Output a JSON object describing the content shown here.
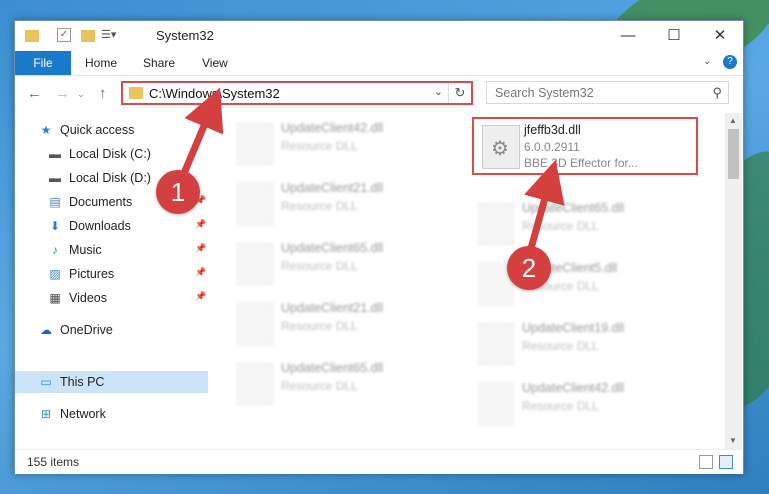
{
  "window": {
    "title": "System32",
    "controls": {
      "minimize": "—",
      "maximize": "☐",
      "close": "✕"
    }
  },
  "ribbon": {
    "tabs": [
      "File",
      "Home",
      "Share",
      "View"
    ],
    "help_icon": "?"
  },
  "address": {
    "path": "C:\\Windows\\System32",
    "search_placeholder": "Search System32"
  },
  "sidebar": {
    "items": [
      {
        "label": "Quick access",
        "icon": "star-icon",
        "pinned": false
      },
      {
        "label": "Local Disk (C:)",
        "icon": "drive-icon",
        "pinned": false
      },
      {
        "label": "Local Disk (D:)",
        "icon": "drive-icon",
        "pinned": false
      },
      {
        "label": "Documents",
        "icon": "document-icon",
        "pinned": true
      },
      {
        "label": "Downloads",
        "icon": "download-icon",
        "pinned": true
      },
      {
        "label": "Music",
        "icon": "music-icon",
        "pinned": true
      },
      {
        "label": "Pictures",
        "icon": "picture-icon",
        "pinned": true
      },
      {
        "label": "Videos",
        "icon": "video-icon",
        "pinned": true
      },
      {
        "label": "OneDrive",
        "icon": "cloud-icon",
        "pinned": false
      },
      {
        "label": "This PC",
        "icon": "computer-icon",
        "pinned": false,
        "selected": true
      },
      {
        "label": "Network",
        "icon": "network-icon",
        "pinned": false
      }
    ]
  },
  "files": {
    "selected": {
      "name": "jfeffb3d.dll",
      "version": "6.0.0.2911",
      "description": "BBE 3D Effector for..."
    },
    "left_column": [
      {
        "name": "UpdateClient42.dll",
        "type": "Resource DLL"
      },
      {
        "name": "UpdateClient21.dll",
        "type": "Resource DLL"
      },
      {
        "name": "UpdateClient65.dll",
        "type": "Resource DLL"
      },
      {
        "name": "UpdateClient21.dll",
        "type": "Resource DLL"
      },
      {
        "name": "UpdateClient65.dll",
        "type": "Resource DLL"
      }
    ],
    "right_column": [
      {
        "name": "UpdateClient65.dll",
        "type": "Resource DLL"
      },
      {
        "name": "UpdateClient5.dll",
        "type": "Resource DLL"
      },
      {
        "name": "UpdateClient19.dll",
        "type": "Resource DLL"
      },
      {
        "name": "UpdateClient42.dll",
        "type": "Resource DLL"
      }
    ]
  },
  "status": {
    "item_count": "155 items"
  },
  "annotations": {
    "badge_1": "1",
    "badge_2": "2",
    "color": "#d43f3f"
  }
}
